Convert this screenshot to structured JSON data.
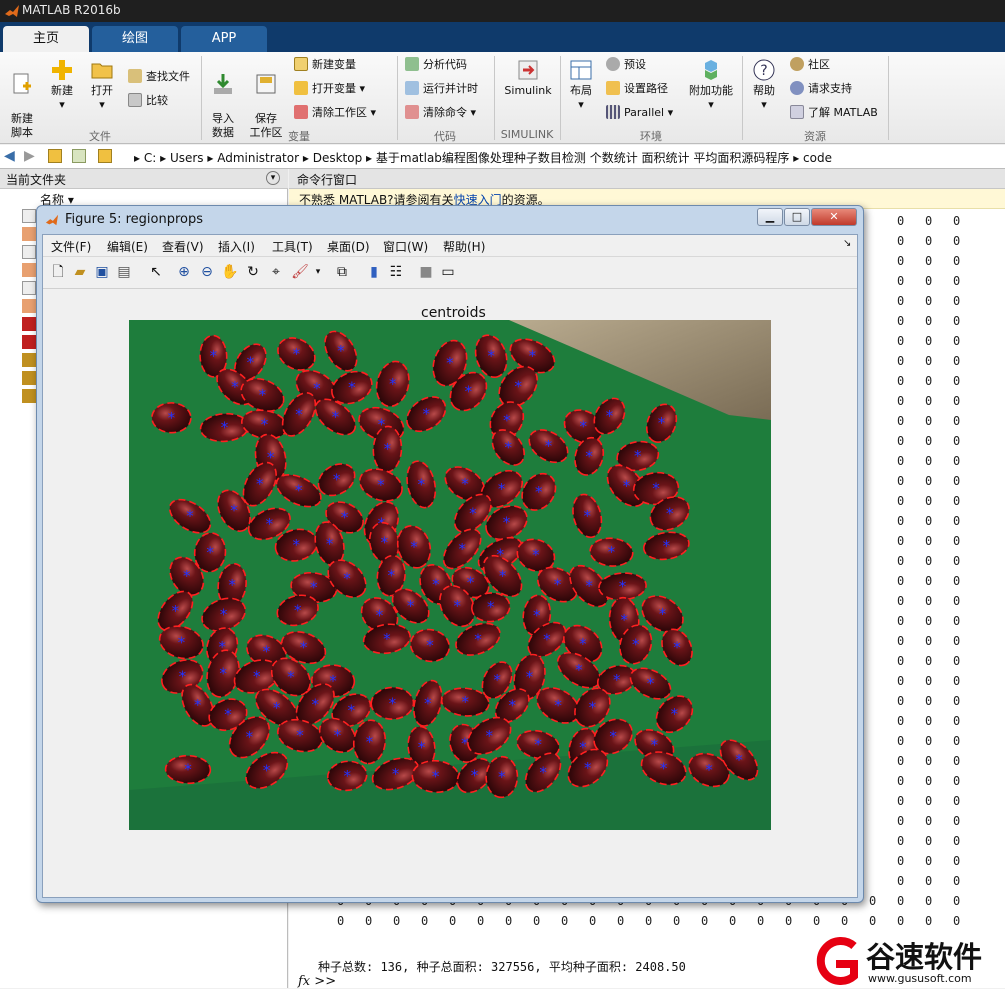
{
  "window": {
    "title": "MATLAB R2016b"
  },
  "tabs": [
    {
      "label": "主页"
    },
    {
      "label": "绘图"
    },
    {
      "label": "APP"
    }
  ],
  "ribbon": {
    "file": {
      "section": "文件",
      "new_script": "新建\n脚本",
      "new": "新建",
      "open": "打开",
      "find_files": "查找文件",
      "compare": "比较"
    },
    "variable": {
      "section": "变量",
      "import": "导入\n数据",
      "save_ws": "保存\n工作区",
      "new_var": "新建变量",
      "open_var": "打开变量",
      "clear_ws": "清除工作区"
    },
    "code": {
      "section": "代码",
      "analyze": "分析代码",
      "run_time": "运行并计时",
      "clear_cmd": "清除命令"
    },
    "simulink": {
      "section": "SIMULINK",
      "label": "Simulink"
    },
    "env": {
      "section": "环境",
      "layout": "布局",
      "prefs": "预设",
      "set_path": "设置路径",
      "parallel": "Parallel",
      "addons": "附加功能"
    },
    "resources": {
      "section": "资源",
      "help": "帮助",
      "community": "社区",
      "support": "请求支持",
      "learn": "了解 MATLAB"
    }
  },
  "address": {
    "crumbs": [
      "C:",
      "Users",
      "Administrator",
      "Desktop",
      "基于matlab编程图像处理种子数目检测 个数统计 面积统计 平均面积源码程序",
      "code"
    ]
  },
  "current_folder": {
    "title": "当前文件夹",
    "column": "名称"
  },
  "command_window": {
    "title": "命令行窗口",
    "notice_pre": "不熟悉 MATLAB?请参阅有关",
    "notice_link": "快速入门",
    "notice_post": "的资源。",
    "zero": "0",
    "status": "种子总数: 136, 种子总面积: 327556, 平均种子面积: 2408.50",
    "prompt": ">>",
    "fx": "fx"
  },
  "figure": {
    "title": "Figure 5: regionprops",
    "menu": [
      "文件(F)",
      "编辑(E)",
      "查看(V)",
      "插入(I)",
      "工具(T)",
      "桌面(D)",
      "窗口(W)",
      "帮助(H)"
    ],
    "axes_title": "centroids"
  },
  "brand": {
    "name": "谷速软件",
    "url": "www.gususoft.com"
  },
  "colors": {
    "accent": "#0f3a6b",
    "tab": "#245f9c",
    "seed": "#6a1418",
    "green": "#1e7d3c",
    "marker": "#2233ff",
    "box": "#ff2020"
  }
}
